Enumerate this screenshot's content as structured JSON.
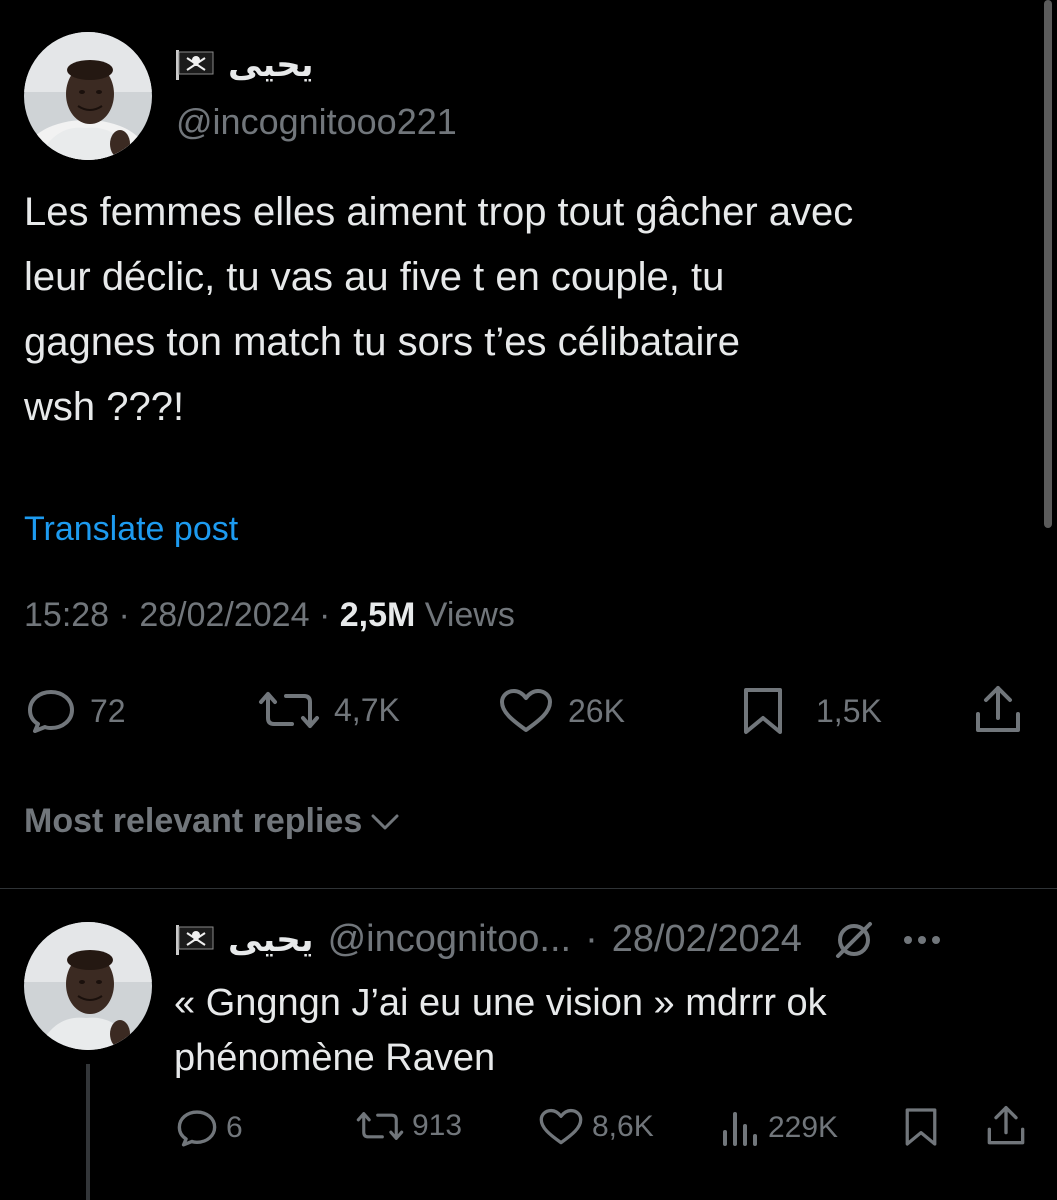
{
  "colors": {
    "background": "#000000",
    "text": "#e7e9ea",
    "secondary": "#71767b",
    "link": "#1d9bf0",
    "divider": "#2f3336"
  },
  "post": {
    "author_name": "يحيى",
    "flag_icon": "pirate-flag-icon",
    "handle": "@incognitooo221",
    "text": "Les femmes elles aiment trop tout gâcher avec\nleur déclic, tu vas au five t en couple, tu\ngagnes ton match tu sors t’es célibataire\nwsh ???!",
    "translate_label": "Translate post",
    "time": "15:28",
    "separator": "·",
    "date": "28/02/2024",
    "views_count": "2,5M",
    "views_label": "Views",
    "actions": {
      "replies": "72",
      "reposts": "4,7K",
      "likes": "26K",
      "bookmarks": "1,5K"
    }
  },
  "replies_sort_label": "Most relevant replies",
  "reply": {
    "author_name": "يحيى",
    "handle": "@incognitoo...",
    "separator": "·",
    "date": "28/02/2024",
    "text": "« Gngngn J’ai eu une vision » mdrrr ok\nphénomène Raven",
    "actions": {
      "replies": "6",
      "reposts": "913",
      "likes": "8,6K",
      "views": "229K"
    }
  }
}
